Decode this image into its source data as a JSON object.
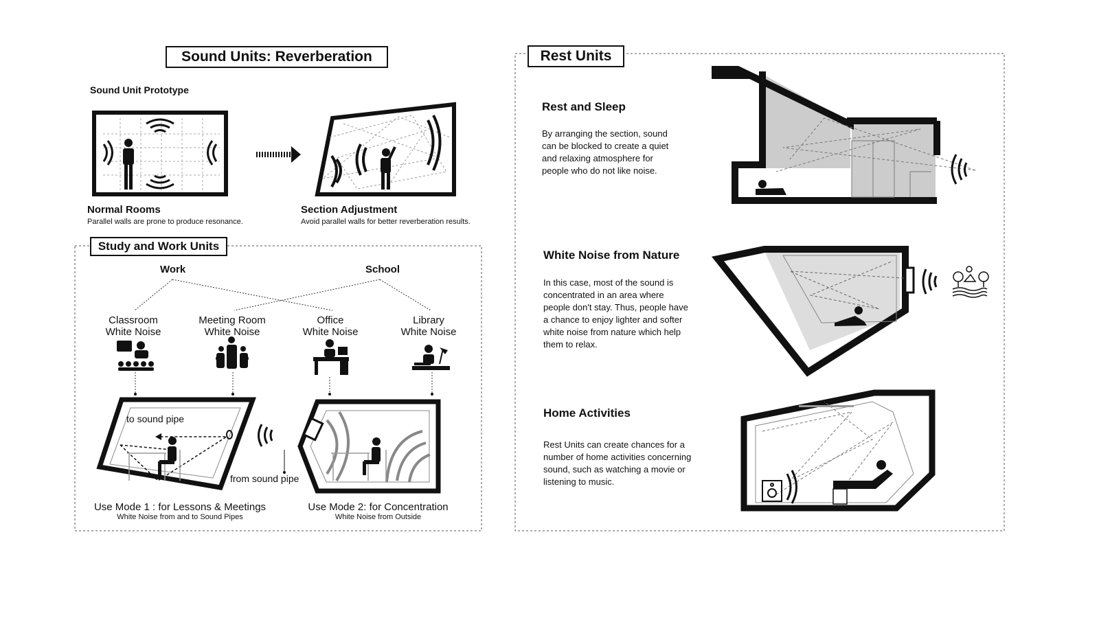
{
  "sound_units": {
    "title": "Sound Units: Reverberation",
    "prototype_label": "Sound Unit Prototype",
    "normal": {
      "heading": "Normal Rooms",
      "caption": "Parallel walls are prone to produce resonance."
    },
    "adjusted": {
      "heading": "Section Adjustment",
      "caption": "Avoid parallel walls for better reverberation results."
    }
  },
  "study_work": {
    "title": "Study and Work Units",
    "group_work": "Work",
    "group_school": "School",
    "noise_types": [
      {
        "line1": "Classroom",
        "line2": "White Noise",
        "icon": "classroom-icon"
      },
      {
        "line1": "Meeting Room",
        "line2": "White Noise",
        "icon": "meeting-icon"
      },
      {
        "line1": "Office",
        "line2": "White Noise",
        "icon": "office-desk-icon"
      },
      {
        "line1": "Library",
        "line2": "White Noise",
        "icon": "library-reading-icon"
      }
    ],
    "mode1": {
      "to_pipe": "to sound pipe",
      "from_pipe": "from sound pipe",
      "title": "Use Mode 1 : for Lessons & Meetings",
      "subtitle": "White Noise from and to Sound Pipes"
    },
    "mode2": {
      "title": "Use Mode 2: for Concentration",
      "subtitle": "White Noise from Outside"
    }
  },
  "rest_units": {
    "title": "Rest Units",
    "sections": [
      {
        "heading": "Rest and Sleep",
        "text": "By arranging the section, sound can be blocked to create a quiet and relaxing atmosphere for people  who do not like noise."
      },
      {
        "heading": "White Noise from Nature",
        "text": "In this case, most of the sound is concentrated in an area where people don't stay. Thus, people have a chance to enjoy lighter and softer white noise from nature which help them to relax."
      },
      {
        "heading": "Home Activities",
        "text": "Rest Units can create chances for a number of home activities concerning sound, such as watching a movie or listening to music."
      }
    ]
  },
  "colors": {
    "ink": "#111111",
    "shade": "#c8c8c8",
    "dash": "#555555"
  }
}
